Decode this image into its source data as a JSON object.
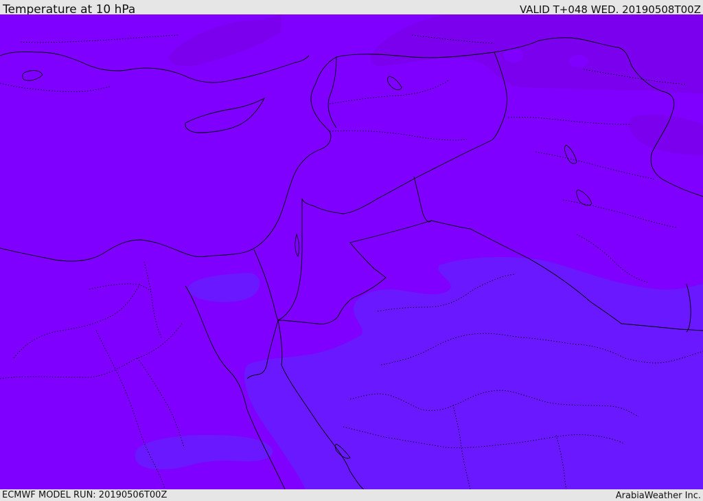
{
  "header": {
    "title": "Temperature at 10 hPa",
    "valid": "VALID T+048 WED. 20190508T00Z"
  },
  "footer": {
    "model_run": "ECMWF MODEL RUN: 20190506T00Z",
    "credit": "ArabiaWeather Inc."
  },
  "map": {
    "field_colors": {
      "base": "#7f00ff",
      "cooler": "#6a18ff",
      "warmer": "#7a00ee",
      "border": "#000000"
    }
  }
}
